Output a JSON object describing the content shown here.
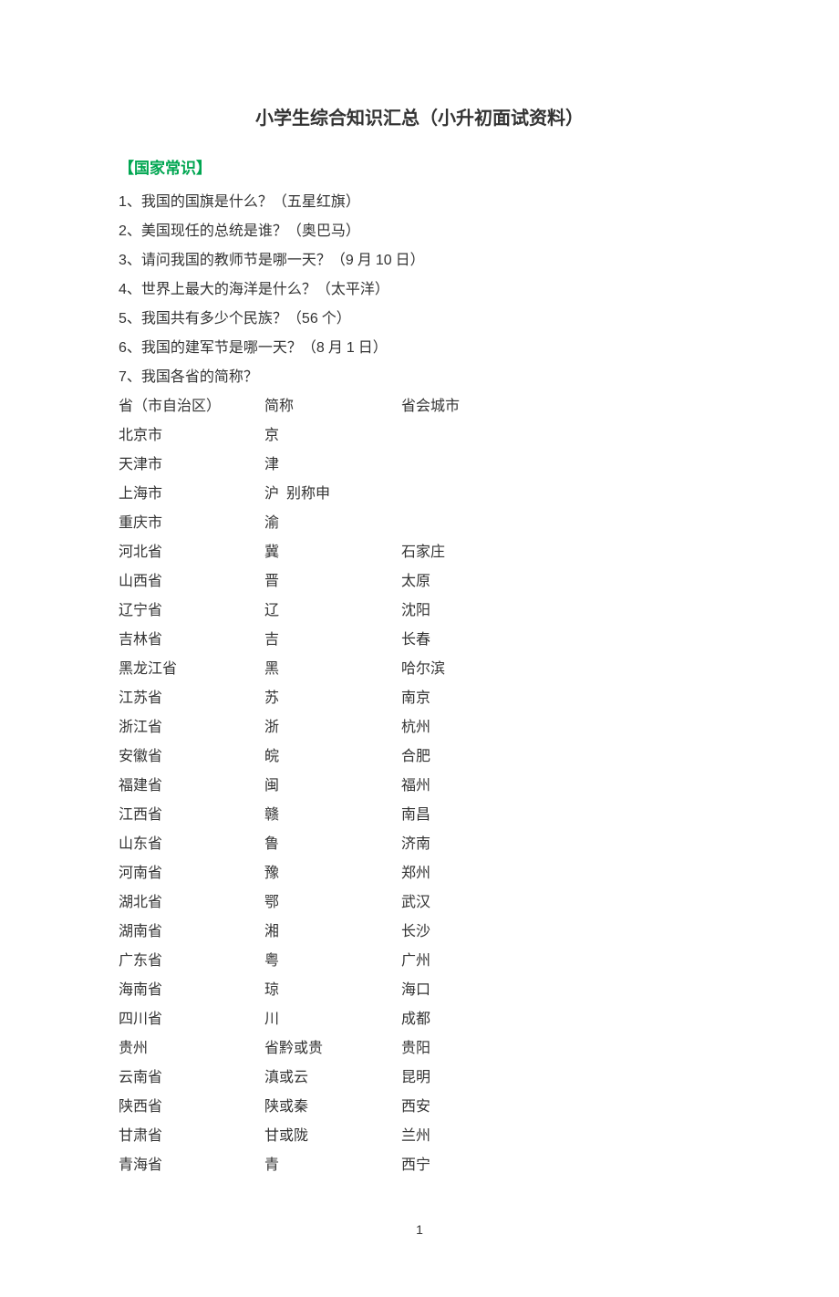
{
  "title": "小学生综合知识汇总（小升初面试资料）",
  "section_heading": "【国家常识】",
  "questions": [
    {
      "num": "1",
      "text": "、我国的国旗是什么？（五星红旗）"
    },
    {
      "num": "2",
      "text": "、美国现任的总统是谁？（奥巴马）"
    },
    {
      "num": "3",
      "text": "、请问我国的教师节是哪一天？（",
      "mid": "9",
      "text2": " 月 ",
      "mid2": "10",
      "text3": " 日）"
    },
    {
      "num": "4",
      "text": "、世界上最大的海洋是什么？（太平洋）"
    },
    {
      "num": "5",
      "text": "、我国共有多少个民族？（",
      "mid": "56",
      "text2": " 个）"
    },
    {
      "num": "6",
      "text": "、我国的建军节是哪一天？（",
      "mid": "8",
      "text2": " 月 ",
      "mid2": "1",
      "text3": " 日）"
    },
    {
      "num": "7",
      "text": "、我国各省的简称？"
    }
  ],
  "table_header": {
    "c1": "省（市自治区）",
    "c2": "简称",
    "c3": "省会城市"
  },
  "provinces": [
    {
      "name": "北京市",
      "abbr": "京",
      "capital": ""
    },
    {
      "name": "天津市",
      "abbr": "津",
      "capital": ""
    },
    {
      "name": "上海市",
      "abbr": "沪  别称申",
      "capital": ""
    },
    {
      "name": "重庆市",
      "abbr": "渝",
      "capital": ""
    },
    {
      "name": "河北省",
      "abbr": "冀",
      "capital": "石家庄"
    },
    {
      "name": "山西省",
      "abbr": "晋",
      "capital": "太原"
    },
    {
      "name": "辽宁省",
      "abbr": "辽",
      "capital": "沈阳"
    },
    {
      "name": "吉林省",
      "abbr": "吉",
      "capital": "长春"
    },
    {
      "name": "黑龙江省",
      "abbr": "黑",
      "capital": "哈尔滨"
    },
    {
      "name": "江苏省",
      "abbr": "苏",
      "capital": "南京"
    },
    {
      "name": "浙江省",
      "abbr": "浙",
      "capital": "杭州"
    },
    {
      "name": "安徽省",
      "abbr": "皖",
      "capital": "合肥"
    },
    {
      "name": "福建省",
      "abbr": "闽",
      "capital": "福州"
    },
    {
      "name": "江西省",
      "abbr": "赣",
      "capital": "南昌"
    },
    {
      "name": "山东省",
      "abbr": "鲁",
      "capital": "济南"
    },
    {
      "name": "河南省",
      "abbr": "豫",
      "capital": "郑州"
    },
    {
      "name": "湖北省",
      "abbr": "鄂",
      "capital": "武汉"
    },
    {
      "name": "湖南省",
      "abbr": "湘",
      "capital": "长沙"
    },
    {
      "name": "广东省",
      "abbr": "粤",
      "capital": "广州"
    },
    {
      "name": "海南省",
      "abbr": "琼",
      "capital": "海口"
    },
    {
      "name": "四川省",
      "abbr": "川",
      "capital": "成都"
    },
    {
      "name": "贵州",
      "abbr": "省黔或贵",
      "capital": "贵阳"
    },
    {
      "name": "云南省",
      "abbr": "滇或云",
      "capital": "昆明"
    },
    {
      "name": "陕西省",
      "abbr": "陕或秦",
      "capital": "西安"
    },
    {
      "name": "甘肃省",
      "abbr": "甘或陇",
      "capital": "兰州"
    },
    {
      "name": "青海省",
      "abbr": "青",
      "capital": "西宁"
    }
  ],
  "page_number": "1"
}
